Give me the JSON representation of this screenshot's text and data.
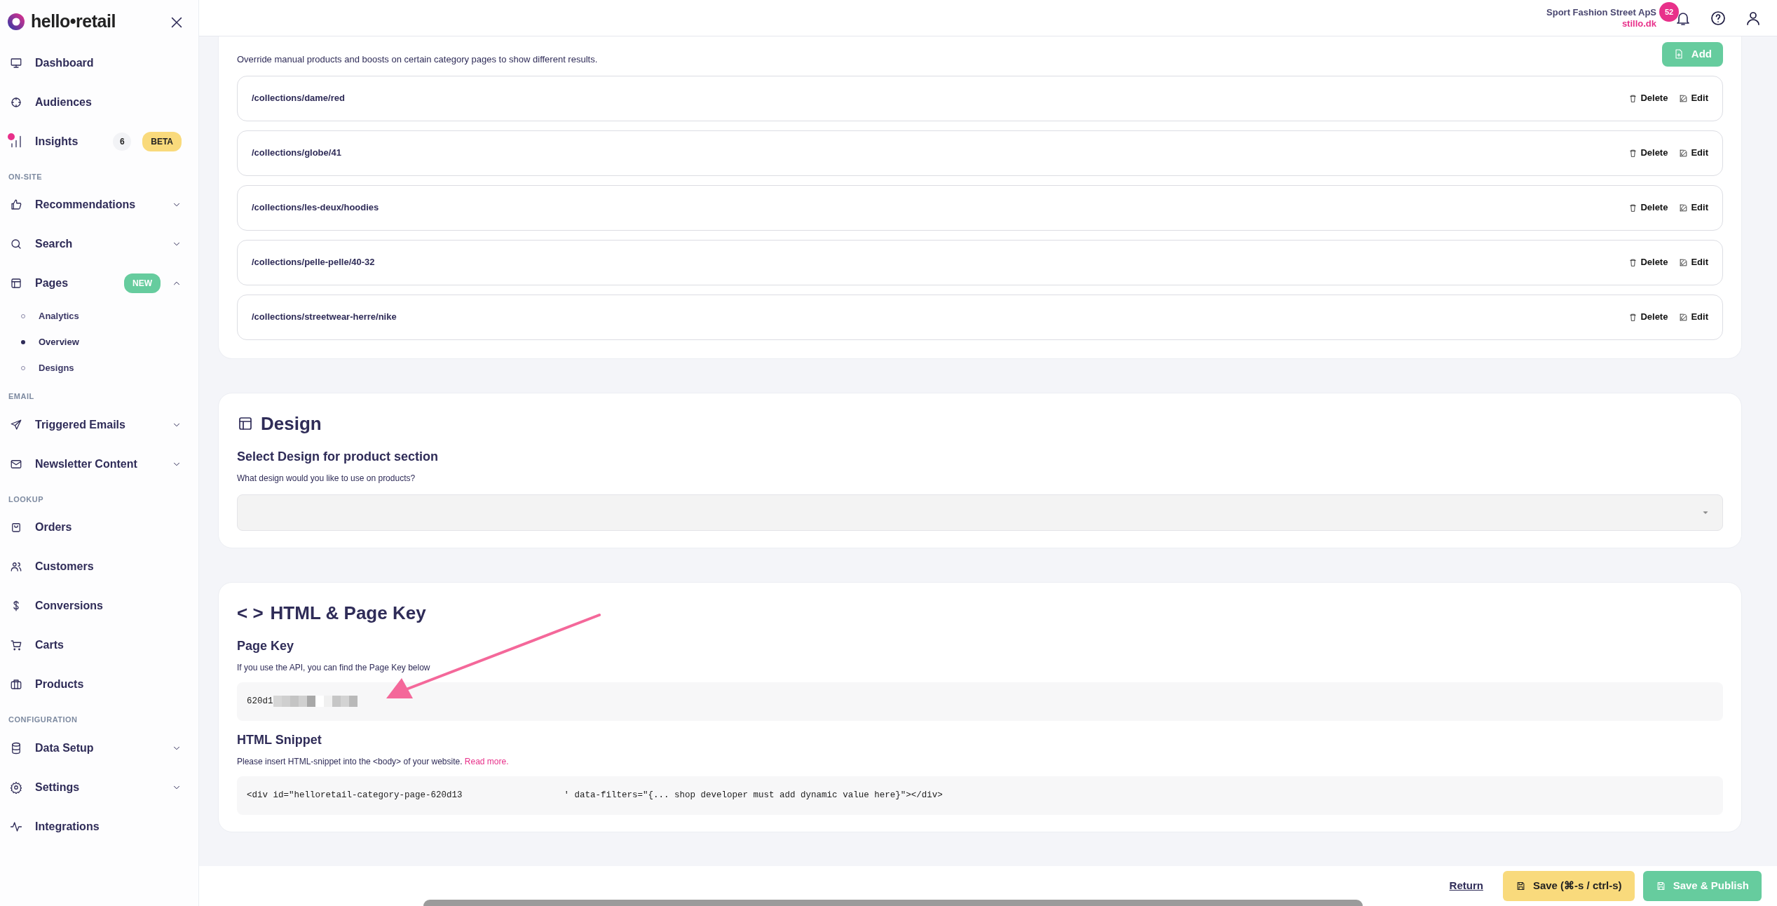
{
  "brand": {
    "name": "hello•retail"
  },
  "sidebar": {
    "sections": [
      {
        "items": [
          {
            "label": "Dashboard"
          },
          {
            "label": "Audiences"
          },
          {
            "label": "Insights",
            "notification": true,
            "count": "6",
            "badge": {
              "text": "BETA",
              "color": "#f9da7c"
            }
          }
        ]
      },
      {
        "heading": "ON-SITE",
        "items": [
          {
            "label": "Recommendations",
            "expanded": false
          },
          {
            "label": "Search",
            "expanded": false
          },
          {
            "label": "Pages",
            "badge": {
              "text": "NEW",
              "color": "#66cc9e"
            },
            "expanded": true,
            "children": [
              {
                "label": "Analytics",
                "selected": false
              },
              {
                "label": "Overview",
                "selected": true
              },
              {
                "label": "Designs",
                "selected": false
              }
            ]
          }
        ]
      },
      {
        "heading": "EMAIL",
        "items": [
          {
            "label": "Triggered Emails",
            "expanded": false
          },
          {
            "label": "Newsletter Content",
            "expanded": false
          }
        ]
      },
      {
        "heading": "LOOKUP",
        "items": [
          {
            "label": "Orders"
          },
          {
            "label": "Customers"
          },
          {
            "label": "Conversions"
          },
          {
            "label": "Carts"
          },
          {
            "label": "Products"
          }
        ]
      },
      {
        "heading": "CONFIGURATION",
        "items": [
          {
            "label": "Data Setup",
            "expanded": false
          },
          {
            "label": "Settings",
            "expanded": false
          },
          {
            "label": "Integrations"
          }
        ]
      }
    ]
  },
  "header": {
    "account": "Sport Fashion Street ApS",
    "domain": "stillo.dk",
    "notifications": "52"
  },
  "category_pages": {
    "description": "Override manual products and boosts on certain category pages to show different results.",
    "add_button": "Add",
    "rows": [
      {
        "path": "/collections/dame/red",
        "delete": "Delete",
        "edit": "Edit"
      },
      {
        "path": "/collections/globe/41",
        "delete": "Delete",
        "edit": "Edit"
      },
      {
        "path": "/collections/les-deux/hoodies",
        "delete": "Delete",
        "edit": "Edit"
      },
      {
        "path": "/collections/pelle-pelle/40-32",
        "delete": "Delete",
        "edit": "Edit"
      },
      {
        "path": "/collections/streetwear-herre/nike",
        "delete": "Delete",
        "edit": "Edit"
      }
    ]
  },
  "design": {
    "title": "Design",
    "subtitle": "Select Design for product section",
    "help": "What design would you like to use on products?"
  },
  "html_key": {
    "icon_text": "< >",
    "title": "HTML & Page Key",
    "page_key_heading": "Page Key",
    "page_key_help": "If you use the API, you can find the Page Key below",
    "page_key_value": "620d1",
    "snippet_heading": "HTML Snippet",
    "snippet_help": "Please insert HTML-snippet into the <body> of your website.",
    "snippet_link": "Read more.",
    "snippet_start": "<div id=\"helloretail-category-page-620d13",
    "snippet_end": "' data-filters=\"{... shop developer must add dynamic value here}\"></div>"
  },
  "footer": {
    "return": "Return",
    "save": "Save (⌘-s / ctrl-s)",
    "publish": "Save & Publish"
  }
}
